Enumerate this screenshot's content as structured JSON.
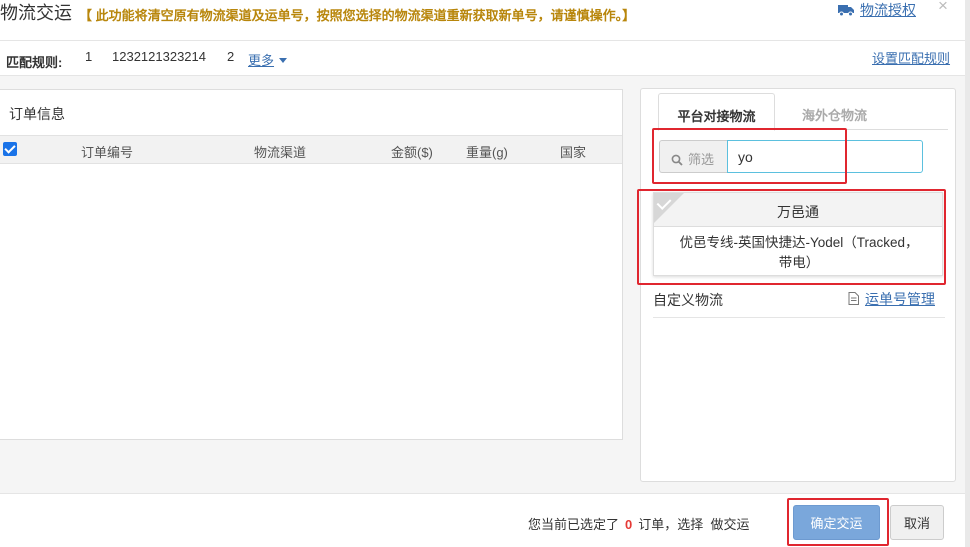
{
  "header": {
    "title": "物流交运",
    "warning": "【 此功能将清空原有物流渠道及运单号，按照您选择的物流渠道重新获取新单号，请谨慎操作。】",
    "auth_link": "物流授权",
    "close": "×"
  },
  "rule_row": {
    "label": "匹配规则:",
    "items": [
      "1",
      "1232121323214",
      "2"
    ],
    "more": "更多",
    "set_link": "设置匹配规则"
  },
  "order_panel": {
    "title": "订单信息",
    "select_all_checked": true,
    "columns": [
      "订单编号",
      "物流渠道",
      "金额($)",
      "重量(g)",
      "国家"
    ],
    "rows": []
  },
  "logistics_panel": {
    "tabs": [
      {
        "label": "平台对接物流",
        "active": true
      },
      {
        "label": "海外仓物流",
        "active": false
      }
    ],
    "filter": {
      "label": "筛选",
      "value": "yo"
    },
    "card": {
      "provider": "万邑通",
      "service_line1": "优邑专线-英国快捷达-Yodel（Tracked，",
      "service_line2": "带电）",
      "selected": true
    },
    "custom_label": "自定义物流",
    "waybill_link": "运单号管理"
  },
  "footer": {
    "status_prefix": "您当前已选定了",
    "selected_count": "0",
    "status_suffix": "订单，选择",
    "status_action": "做交运",
    "confirm_label": "确定交运",
    "cancel_label": "取消"
  },
  "colors": {
    "link": "#3a6fb0",
    "warning": "#b8860b",
    "highlight": "#e0262f",
    "primary_button": "#7aa7db",
    "count": "#e53935"
  }
}
